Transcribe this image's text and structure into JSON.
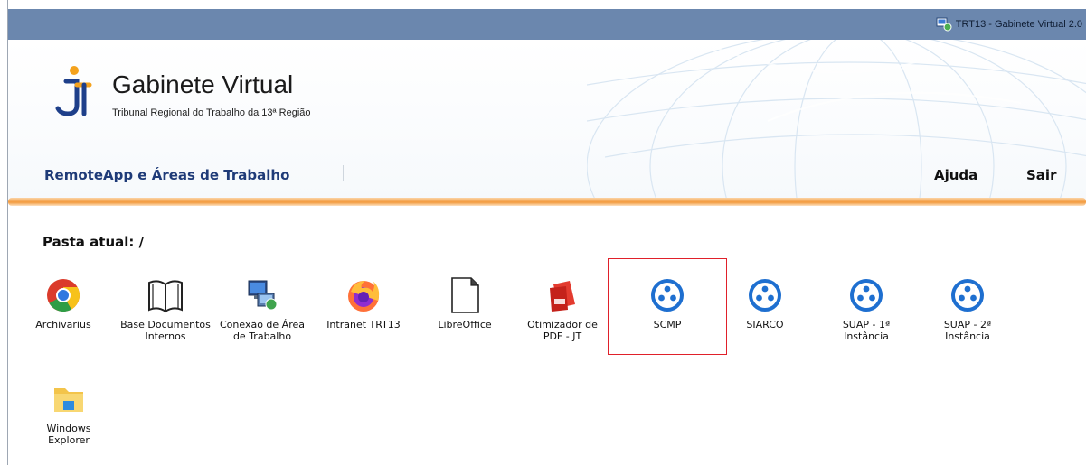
{
  "window": {
    "title": "TRT13 - Gabinete Virtual 2.0",
    "icon": "remote-desktop-icon"
  },
  "header": {
    "title": "Gabinete Virtual",
    "subtitle": "Tribunal Regional do Trabalho da 13ª Região",
    "logo": "trt-logo"
  },
  "nav": {
    "main_link": "RemoteApp e Áreas de Trabalho",
    "help": "Ajuda",
    "exit": "Sair"
  },
  "folder": {
    "label": "Pasta atual: /"
  },
  "apps": [
    {
      "label": "Archivarius",
      "icon": "chrome-icon"
    },
    {
      "label": "Base Documentos Internos",
      "icon": "book-icon"
    },
    {
      "label": "Conexão de Área de Trabalho",
      "icon": "remote-desktop-connection-icon"
    },
    {
      "label": "Intranet TRT13",
      "icon": "firefox-icon"
    },
    {
      "label": "LibreOffice",
      "icon": "document-icon"
    },
    {
      "label": "Otimizador de PDF - JT",
      "icon": "pdf-icon"
    },
    {
      "label": "SCMP",
      "icon": "remoteapp-icon",
      "selected": true
    },
    {
      "label": "SIARCO",
      "icon": "remoteapp-icon"
    },
    {
      "label": "SUAP - 1ª Instância",
      "icon": "remoteapp-icon"
    },
    {
      "label": "SUAP - 2ª Instância",
      "icon": "remoteapp-icon"
    },
    {
      "label": "Windows Explorer",
      "icon": "folder-icon"
    }
  ],
  "colors": {
    "titlebar": "#6b87ae",
    "nav_link": "#1f3b78",
    "accent_orange": "#f39a3d",
    "selection_border": "#e0202a",
    "remoteapp_blue": "#1e6fd0"
  }
}
